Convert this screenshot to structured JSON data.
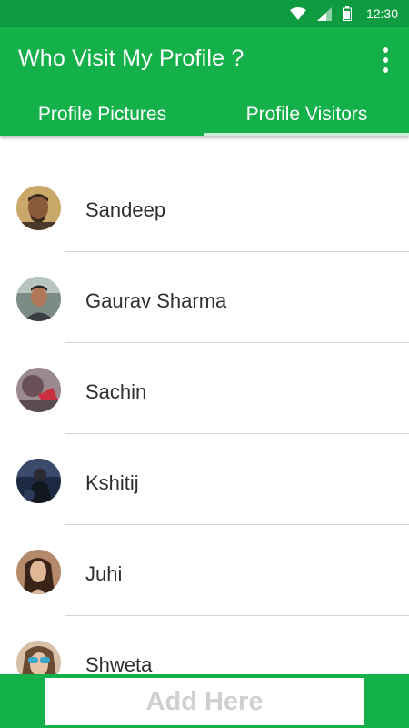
{
  "status_bar": {
    "time": "12:30",
    "icons": [
      "wifi-icon",
      "signal-icon",
      "battery-icon"
    ],
    "background": "#0f9b40"
  },
  "app_bar": {
    "title": "Who Visit My Profile ?",
    "menu_icon": "more-vert-icon",
    "background": "#14b04a"
  },
  "tabs": [
    {
      "label": "Profile Pictures",
      "active": false
    },
    {
      "label": "Profile Visitors",
      "active": true
    }
  ],
  "visitors": [
    {
      "name": "Sandeep"
    },
    {
      "name": "Gaurav Sharma"
    },
    {
      "name": "Sachin"
    },
    {
      "name": "Kshitij"
    },
    {
      "name": "Juhi"
    },
    {
      "name": "Shweta"
    }
  ],
  "ad_banner": {
    "label": "Add Here"
  }
}
